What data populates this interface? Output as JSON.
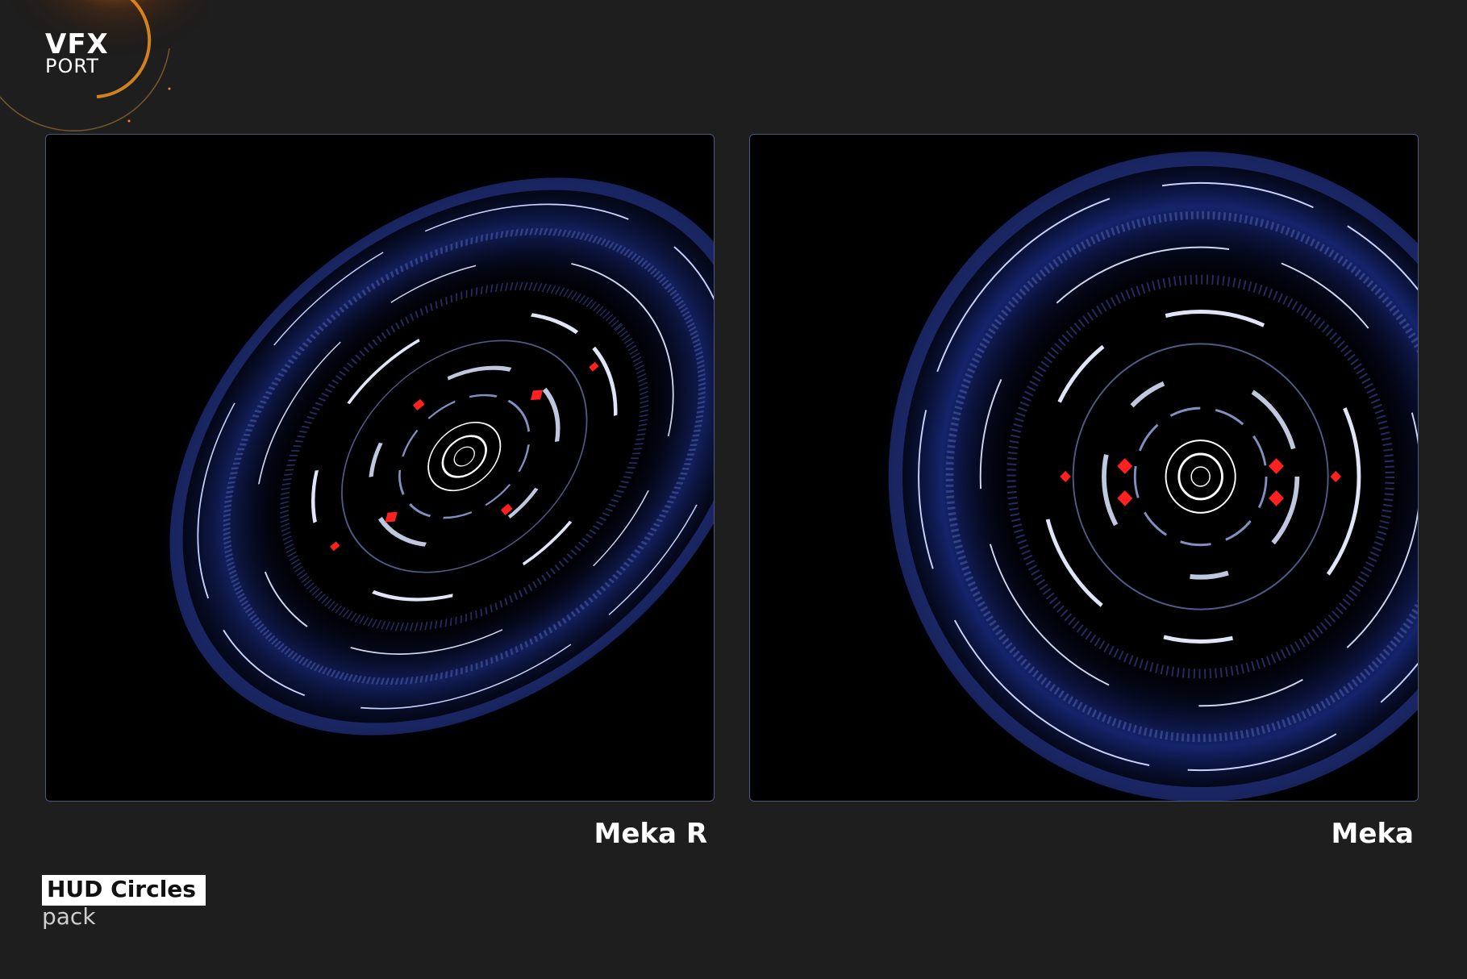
{
  "logo": {
    "line1": "VFX",
    "line2": "PORT"
  },
  "previews": [
    {
      "caption": "Meka R"
    },
    {
      "caption": "Meka"
    }
  ],
  "product": {
    "title": "HUD Circles",
    "subtitle": "pack"
  },
  "colors": {
    "background": "#1e1e1e",
    "panel_border": "#4a5a7a",
    "hud_blue": "#1c3c9c",
    "hud_accent": "#ff2020",
    "flare": "#ff9a20"
  }
}
